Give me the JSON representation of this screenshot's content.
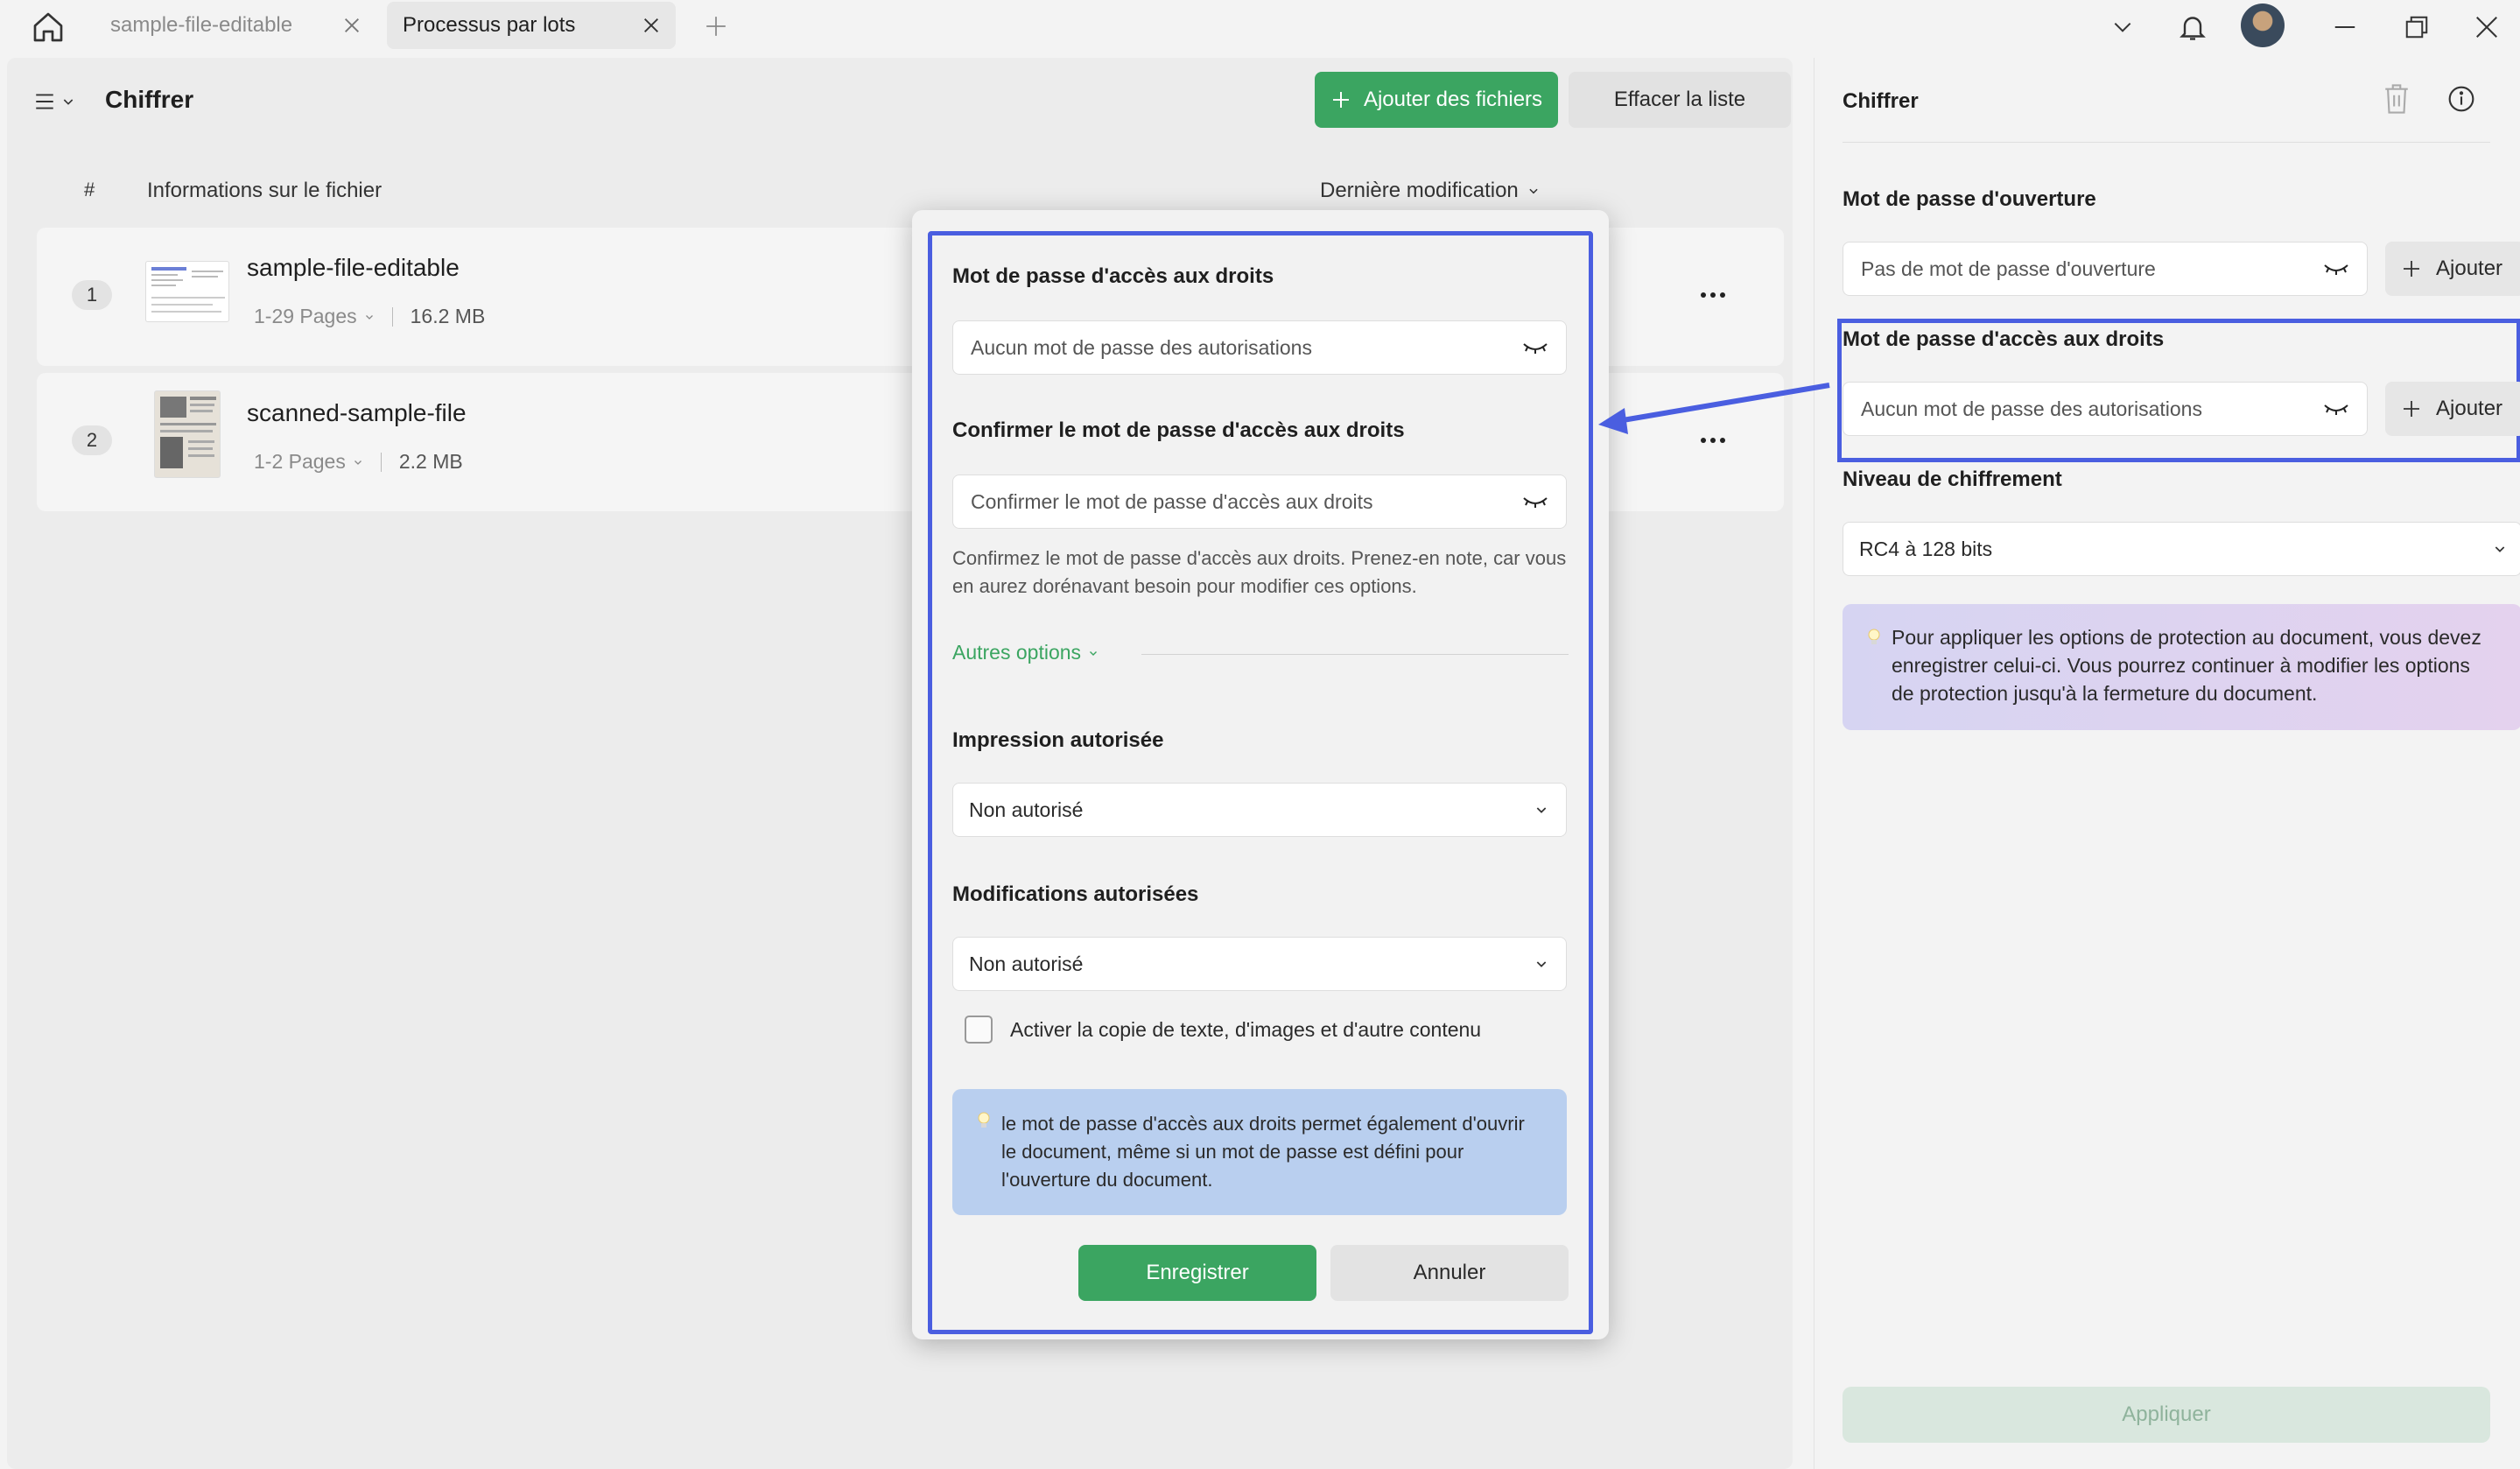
{
  "tabs": [
    {
      "label": "sample-file-editable",
      "active": false
    },
    {
      "label": "Processus par lots",
      "active": true
    }
  ],
  "main": {
    "title": "Chiffrer",
    "add_files_label": "Ajouter des fichiers",
    "clear_list_label": "Effacer la liste",
    "columns": {
      "hash": "#",
      "info": "Informations sur le fichier",
      "sort": "Dernière modification"
    },
    "files": [
      {
        "num": "1",
        "name": "sample-file-editable",
        "pages": "1-29 Pages",
        "size": "16.2 MB"
      },
      {
        "num": "2",
        "name": "scanned-sample-file",
        "pages": "1-2 Pages",
        "size": "2.2 MB"
      }
    ]
  },
  "modal": {
    "perm_label": "Mot de passe d'accès aux droits",
    "perm_placeholder": "Aucun mot de passe des autorisations",
    "confirm_label": "Confirmer le mot de passe d'accès aux droits",
    "confirm_placeholder": "Confirmer le mot de passe d'accès aux droits",
    "hint": "Confirmez le mot de passe d'accès aux droits. Prenez-en note, car vous en aurez dorénavant besoin pour modifier ces options.",
    "more_options": "Autres options",
    "print_label": "Impression autorisée",
    "print_value": "Non autorisé",
    "changes_label": "Modifications autorisées",
    "changes_value": "Non autorisé",
    "copy_label": "Activer la copie de texte, d'images et d'autre contenu",
    "info": "le mot de passe d'accès aux droits permet également d'ouvrir le document, même si un mot de passe est défini pour l'ouverture du document.",
    "save_label": "Enregistrer",
    "cancel_label": "Annuler"
  },
  "sidebar": {
    "title": "Chiffrer",
    "open_label": "Mot de passe d'ouverture",
    "open_placeholder": "Pas de mot de passe d'ouverture",
    "add_label": "Ajouter",
    "perm_label": "Mot de passe d'accès aux droits",
    "perm_placeholder": "Aucun mot de passe des autorisations",
    "level_label": "Niveau de chiffrement",
    "level_value": "RC4 à 128 bits",
    "note": "Pour appliquer les options de protection au document, vous devez enregistrer celui-ci. Vous pourrez continuer à modifier les options de protection jusqu'à la fermeture du document.",
    "apply_label": "Appliquer"
  },
  "colors": {
    "accent_green": "#3ba561",
    "highlight_blue": "#4a5ee0"
  }
}
